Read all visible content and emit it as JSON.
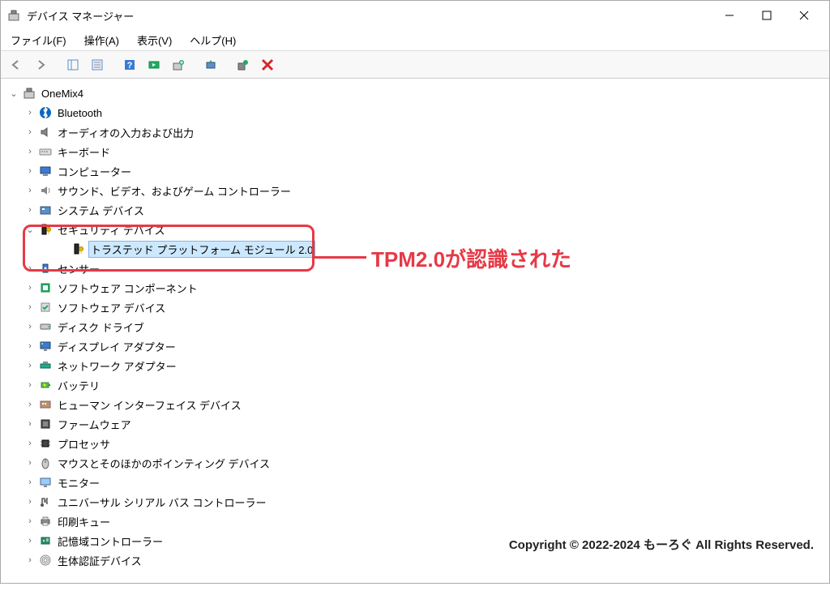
{
  "window": {
    "title": "デバイス マネージャー"
  },
  "menubar": {
    "file": "ファイル(F)",
    "action": "操作(A)",
    "view": "表示(V)",
    "help": "ヘルプ(H)"
  },
  "tree": {
    "root": "OneMix4",
    "items": [
      {
        "label": "Bluetooth",
        "icon": "bluetooth"
      },
      {
        "label": "オーディオの入力および出力",
        "icon": "audio"
      },
      {
        "label": "キーボード",
        "icon": "keyboard"
      },
      {
        "label": "コンピューター",
        "icon": "computer"
      },
      {
        "label": "サウンド、ビデオ、およびゲーム コントローラー",
        "icon": "sound"
      },
      {
        "label": "システム デバイス",
        "icon": "system"
      },
      {
        "label": "セキュリティ デバイス",
        "icon": "security",
        "expanded": true,
        "children": [
          {
            "label": "トラステッド プラットフォーム モジュール 2.0",
            "icon": "security",
            "selected": true
          }
        ]
      },
      {
        "label": "センサー",
        "icon": "sensor"
      },
      {
        "label": "ソフトウェア コンポーネント",
        "icon": "swcomp"
      },
      {
        "label": "ソフトウェア デバイス",
        "icon": "swdev"
      },
      {
        "label": "ディスク ドライブ",
        "icon": "disk"
      },
      {
        "label": "ディスプレイ アダプター",
        "icon": "display"
      },
      {
        "label": "ネットワーク アダプター",
        "icon": "network"
      },
      {
        "label": "バッテリ",
        "icon": "battery"
      },
      {
        "label": "ヒューマン インターフェイス デバイス",
        "icon": "hid"
      },
      {
        "label": "ファームウェア",
        "icon": "firmware"
      },
      {
        "label": "プロセッサ",
        "icon": "cpu"
      },
      {
        "label": "マウスとそのほかのポインティング デバイス",
        "icon": "mouse"
      },
      {
        "label": "モニター",
        "icon": "monitor"
      },
      {
        "label": "ユニバーサル シリアル バス コントローラー",
        "icon": "usb"
      },
      {
        "label": "印刷キュー",
        "icon": "printer"
      },
      {
        "label": "記憶域コントローラー",
        "icon": "storage"
      },
      {
        "label": "生体認証デバイス",
        "icon": "biometric"
      }
    ]
  },
  "annotation": {
    "text": "TPM2.0が認識された"
  },
  "copyright": "Copyright © 2022-2024 もーろぐ All Rights Reserved."
}
